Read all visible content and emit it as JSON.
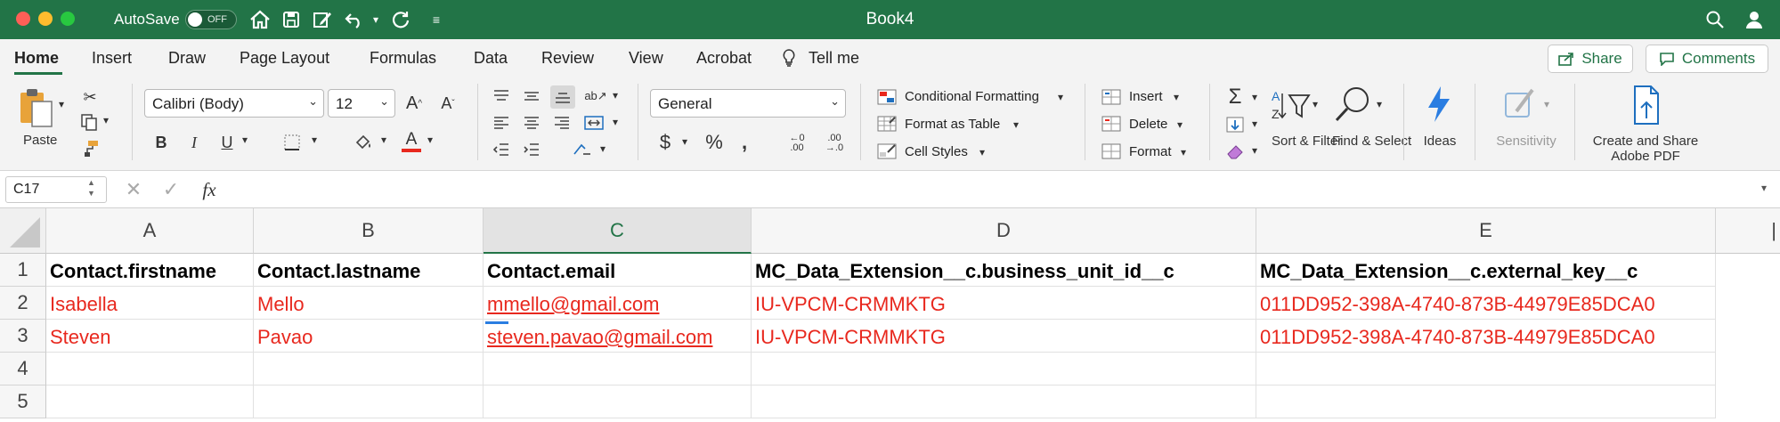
{
  "titlebar": {
    "title": "Book4",
    "autosave_label": "AutoSave",
    "autosave_state": "OFF"
  },
  "menu": {
    "tabs": [
      "Home",
      "Insert",
      "Draw",
      "Page Layout",
      "Formulas",
      "Data",
      "Review",
      "View",
      "Acrobat",
      "Tell me"
    ],
    "share_label": "Share",
    "comments_label": "Comments"
  },
  "ribbon": {
    "paste_label": "Paste",
    "font_name": "Calibri (Body)",
    "font_size": "12",
    "number_format": "General",
    "conditional_formatting": "Conditional Formatting",
    "format_as_table": "Format as Table",
    "cell_styles": "Cell Styles",
    "insert": "Insert",
    "delete": "Delete",
    "format": "Format",
    "sort_filter": "Sort & Filter",
    "find_select": "Find & Select",
    "ideas": "Ideas",
    "sensitivity": "Sensitivity",
    "create_share": "Create and Share Adobe PDF"
  },
  "formula_bar": {
    "name_box": "C17",
    "fx": "fx",
    "formula": ""
  },
  "sheet": {
    "columns": [
      "A",
      "B",
      "C",
      "D",
      "E"
    ],
    "selected_column": "C",
    "rows": [
      "1",
      "2",
      "3",
      "4",
      "5"
    ],
    "header": [
      "Contact.firstname",
      "Contact.lastname",
      "Contact.email",
      "MC_Data_Extension__c.business_unit_id__c",
      "MC_Data_Extension__c.external_key__c"
    ],
    "data": [
      [
        "Isabella",
        "Mello",
        "mmello@gmail.com",
        "IU-VPCM-CRMMKTG",
        "011DD952-398A-4740-873B-44979E85DCA0"
      ],
      [
        "Steven",
        "Pavao",
        "steven.pavao@gmail.com",
        "IU-VPCM-CRMMKTG",
        "011DD952-398A-4740-873B-44979E85DCA0"
      ]
    ],
    "data_text_color": "#e8281e"
  }
}
